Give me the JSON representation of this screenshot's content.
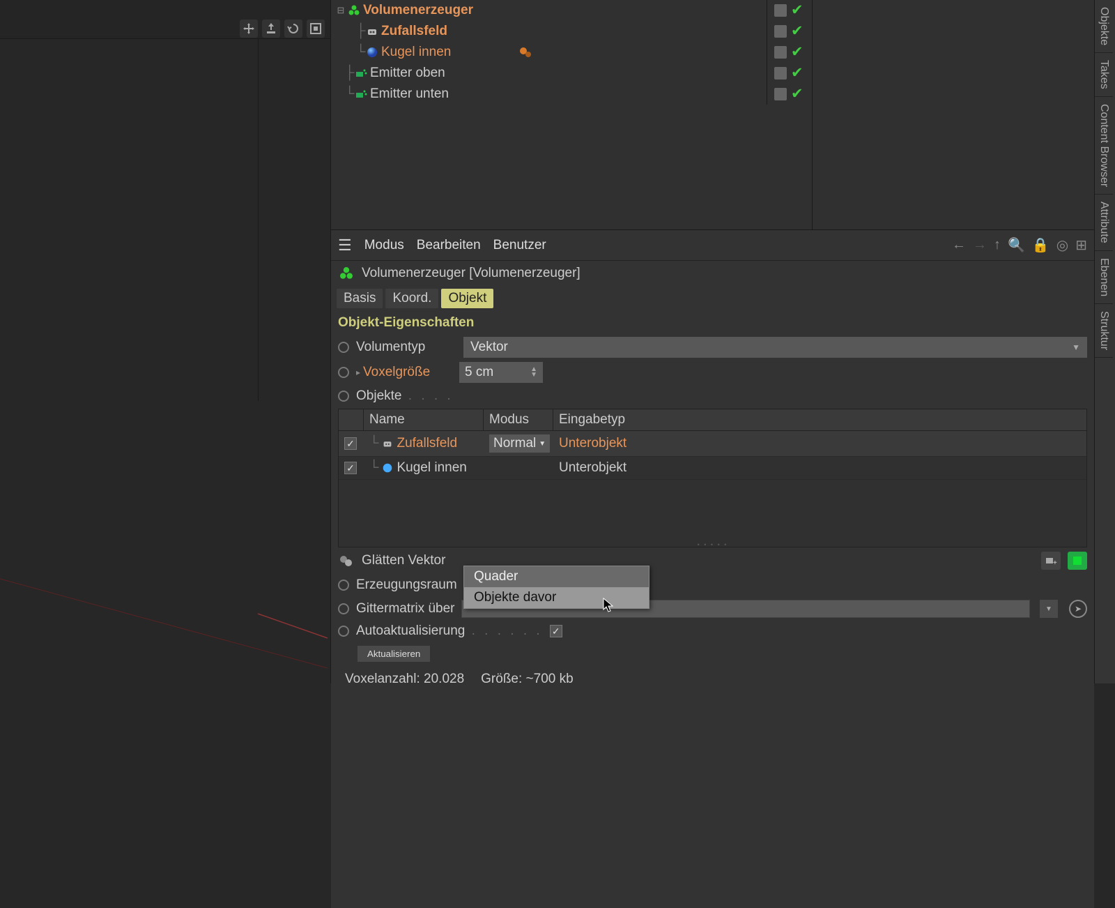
{
  "viewport": {},
  "vtabs": [
    "Objekte",
    "Takes",
    "Content Browser",
    "Attribute",
    "Ebenen",
    "Struktur"
  ],
  "tree": {
    "items": [
      {
        "label": "Volumenerzeuger",
        "color": "#e8955a",
        "bold": true,
        "indent": 0
      },
      {
        "label": "Zufallsfeld",
        "color": "#e8955a",
        "bold": true,
        "indent": 1
      },
      {
        "label": "Kugel innen",
        "color": "#e8955a",
        "bold": false,
        "indent": 1
      },
      {
        "label": "Emitter oben",
        "color": "#ddd",
        "bold": false,
        "indent": 0
      },
      {
        "label": "Emitter unten",
        "color": "#ddd",
        "bold": false,
        "indent": 0
      }
    ]
  },
  "attr": {
    "menus": {
      "modus": "Modus",
      "bearbeiten": "Bearbeiten",
      "benutzer": "Benutzer"
    },
    "object_title": "Volumenerzeuger [Volumenerzeuger]",
    "tabs": {
      "basis": "Basis",
      "koord": "Koord.",
      "objekt": "Objekt"
    },
    "section": "Objekt-Eigenschaften",
    "volumentyp_label": "Volumentyp",
    "volumentyp_value": "Vektor",
    "voxel_label": "Voxelgröße",
    "voxel_value": "5 cm",
    "objekte_label": "Objekte",
    "table": {
      "headers": {
        "name": "Name",
        "modus": "Modus",
        "eingabetyp": "Eingabetyp"
      },
      "rows": [
        {
          "name": "Zufallsfeld",
          "modus": "Normal",
          "eingabetyp": "Unterobjekt",
          "orange": true
        },
        {
          "name": "Kugel innen",
          "modus": "",
          "eingabetyp": "Unterobjekt",
          "orange": false
        }
      ]
    },
    "glaetten": "Glätten Vektor",
    "erzeugungsraum_label": "Erzeugungsraum",
    "erzeugungsraum_value": "Objekte davor",
    "erzeugungsraum_options": [
      "Quader",
      "Objekte davor"
    ],
    "gittermatrix_label": "Gittermatrix über",
    "autoaktualisierung_label": "Autoaktualisierung",
    "aktualisieren_btn": "Aktualisieren",
    "status_voxel": "Voxelanzahl: 20.028",
    "status_size": "Größe: ~700 kb"
  }
}
